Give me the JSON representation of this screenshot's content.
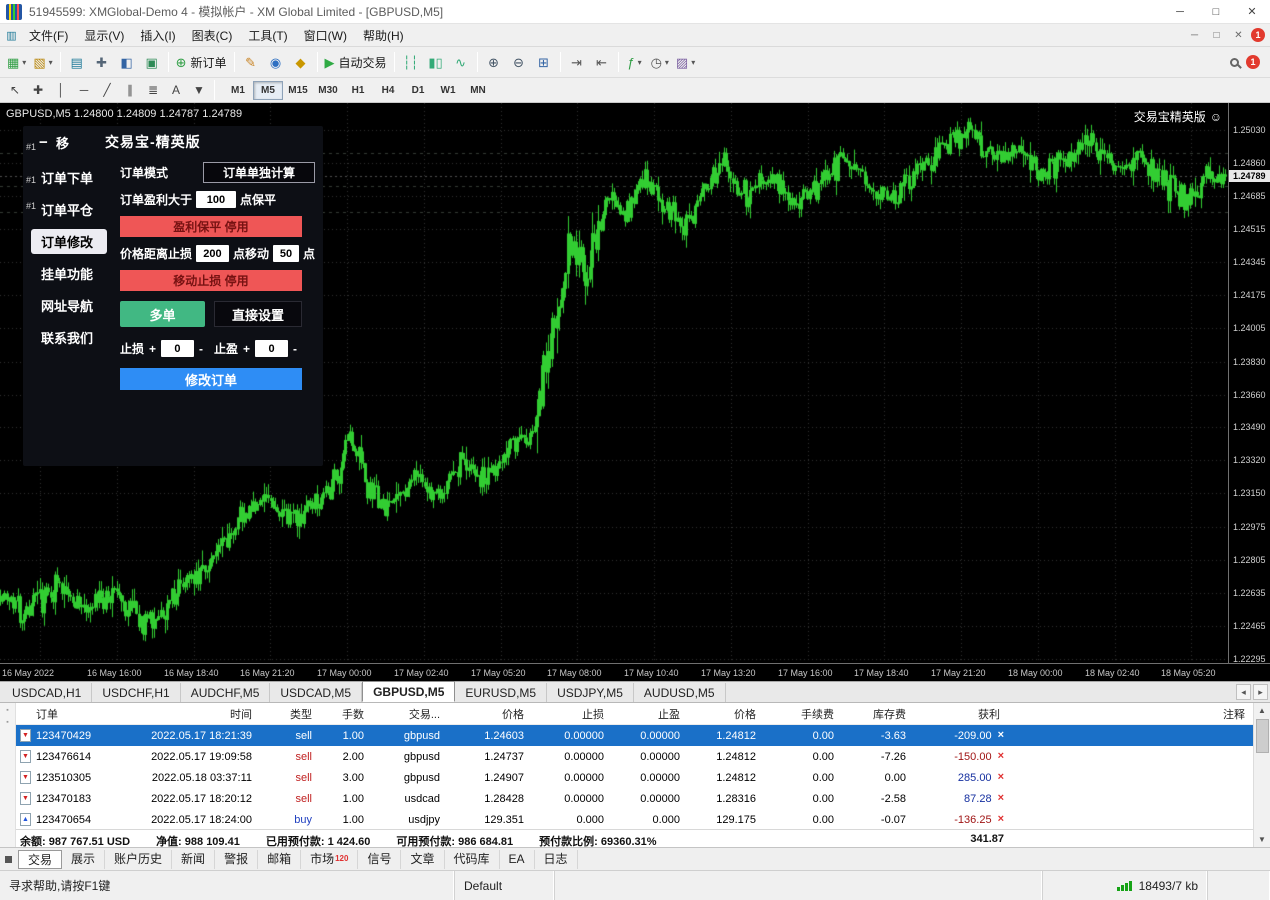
{
  "window": {
    "title": "51945599: XMGlobal-Demo 4 - 模拟帐户 - XM Global Limited - [GBPUSD,M5]",
    "minimize": "─",
    "maximize": "□",
    "close": "✕"
  },
  "menubar": {
    "items": [
      "文件(F)",
      "显示(V)",
      "插入(I)",
      "图表(C)",
      "工具(T)",
      "窗口(W)",
      "帮助(H)"
    ],
    "child_icon": "▥",
    "child_minimize": "─",
    "child_restore": "□",
    "child_close": "✕",
    "badge": "1"
  },
  "toolbar": {
    "groups": [
      {
        "buttons": [
          {
            "name": "new-chart",
            "glyph": "▦",
            "color": "#2f9e44",
            "dropdown": true
          },
          {
            "name": "profiles",
            "glyph": "▧",
            "color": "#b8860b",
            "dropdown": true
          }
        ]
      },
      {
        "buttons": [
          {
            "name": "market-watch",
            "glyph": "▤",
            "color": "#1f7a99"
          },
          {
            "name": "data-window",
            "glyph": "✚",
            "color": "#556677"
          },
          {
            "name": "navigator",
            "glyph": "◧",
            "color": "#3465a4"
          },
          {
            "name": "terminal",
            "glyph": "▣",
            "color": "#2e8b57"
          }
        ]
      },
      {
        "buttons": [
          {
            "name": "new-order",
            "glyph": "⊕",
            "color": "#2f9e44",
            "label": "新订单"
          }
        ]
      },
      {
        "buttons": [
          {
            "name": "metaeditor",
            "glyph": "✎",
            "color": "#c7801f"
          },
          {
            "name": "mql5-community",
            "glyph": "◉",
            "color": "#2d6fc2"
          },
          {
            "name": "market",
            "glyph": "◆",
            "color": "#c99700"
          }
        ]
      },
      {
        "buttons": [
          {
            "name": "autotrading",
            "glyph": "▶",
            "color": "#2faa44",
            "label": "自动交易"
          }
        ]
      },
      {
        "buttons": [
          {
            "name": "bar-chart",
            "glyph": "┆┆",
            "color": "#33aa77"
          },
          {
            "name": "candlestick-chart",
            "glyph": "▮▯",
            "color": "#33aa77"
          },
          {
            "name": "line-chart",
            "glyph": "∿",
            "color": "#33aa77"
          }
        ]
      },
      {
        "buttons": [
          {
            "name": "zoom-in",
            "glyph": "⊕",
            "color": "#445566"
          },
          {
            "name": "zoom-out",
            "glyph": "⊖",
            "color": "#445566"
          },
          {
            "name": "tile-windows",
            "glyph": "⊞",
            "color": "#3465a4"
          }
        ]
      },
      {
        "buttons": [
          {
            "name": "auto-scroll",
            "glyph": "⇥",
            "color": "#555555"
          },
          {
            "name": "chart-shift",
            "glyph": "⇤",
            "color": "#555555"
          }
        ]
      },
      {
        "buttons": [
          {
            "name": "indicators",
            "glyph": "ƒ",
            "color": "#2f9e44",
            "dropdown": true
          },
          {
            "name": "periods",
            "glyph": "◷",
            "color": "#555555",
            "dropdown": true
          },
          {
            "name": "templates",
            "glyph": "▨",
            "color": "#7a5fa0",
            "dropdown": true
          }
        ]
      }
    ],
    "badge": "1"
  },
  "drawing_tools": [
    {
      "name": "cursor",
      "glyph": "↖"
    },
    {
      "name": "crosshair",
      "glyph": "✚"
    },
    {
      "name": "vertical-line",
      "glyph": "│"
    },
    {
      "name": "horizontal-line",
      "glyph": "─"
    },
    {
      "name": "trendline",
      "glyph": "╱"
    },
    {
      "name": "equidistant-channel",
      "glyph": "∥"
    },
    {
      "name": "fibonacci-retracement",
      "glyph": "≣"
    },
    {
      "name": "text",
      "glyph": "A"
    },
    {
      "name": "arrow-objects",
      "glyph": "▼"
    }
  ],
  "timeframes": {
    "items": [
      "M1",
      "M5",
      "M15",
      "M30",
      "H1",
      "H4",
      "D1",
      "W1",
      "MN"
    ],
    "active": "M5"
  },
  "chart": {
    "ohlc_label": "GBPUSD,M5 1.24800 1.24809 1.24787 1.24789",
    "watermark": "交易宝精英版",
    "watermark_icon": "☺",
    "order_markers": [
      "#1",
      "#1",
      "#1"
    ],
    "price_axis_labels": [
      "1.25030",
      "1.24860",
      "1.24685",
      "1.24515",
      "1.24345",
      "1.24175",
      "1.24005",
      "1.23830",
      "1.23660",
      "1.23490",
      "1.23320",
      "1.23150",
      "1.22975",
      "1.22805",
      "1.22635",
      "1.22465",
      "1.22295"
    ],
    "current_price": "1.24789",
    "time_axis_labels": [
      "16 May 2022",
      "16 May 16:00",
      "16 May 18:40",
      "16 May 21:20",
      "17 May 00:00",
      "17 May 02:40",
      "17 May 05:20",
      "17 May 08:00",
      "17 May 10:40",
      "17 May 13:20",
      "17 May 16:00",
      "17 May 18:40",
      "17 May 21:20",
      "18 May 00:00",
      "18 May 02:40",
      "18 May 05:20"
    ]
  },
  "chart_data": {
    "type": "candlestick",
    "symbol": "GBPUSD",
    "timeframe": "M5",
    "last_ohlc": {
      "open": 1.248,
      "high": 1.24809,
      "low": 1.24787,
      "close": 1.24789
    },
    "ylim": [
      1.22272,
      1.25168
    ],
    "up_color": "#32cd32",
    "down_color": "#32cd32",
    "background": "#000000",
    "grid_color": "#333333",
    "order_line_prices": [
      1.24907,
      1.24737,
      1.24603
    ],
    "price_path": [
      [
        0.0,
        1.2262
      ],
      [
        0.02,
        1.2253
      ],
      [
        0.045,
        1.2266
      ],
      [
        0.07,
        1.2256
      ],
      [
        0.095,
        1.2262
      ],
      [
        0.115,
        1.2248
      ],
      [
        0.135,
        1.2257
      ],
      [
        0.155,
        1.2272
      ],
      [
        0.175,
        1.2282
      ],
      [
        0.195,
        1.2302
      ],
      [
        0.215,
        1.2312
      ],
      [
        0.235,
        1.2299
      ],
      [
        0.255,
        1.231
      ],
      [
        0.275,
        1.2322
      ],
      [
        0.285,
        1.2344
      ],
      [
        0.3,
        1.2318
      ],
      [
        0.315,
        1.2305
      ],
      [
        0.335,
        1.2325
      ],
      [
        0.355,
        1.2312
      ],
      [
        0.375,
        1.233
      ],
      [
        0.395,
        1.2322
      ],
      [
        0.415,
        1.2338
      ],
      [
        0.435,
        1.2345
      ],
      [
        0.45,
        1.2392
      ],
      [
        0.465,
        1.2448
      ],
      [
        0.48,
        1.2428
      ],
      [
        0.495,
        1.247
      ],
      [
        0.51,
        1.2458
      ],
      [
        0.525,
        1.2478
      ],
      [
        0.545,
        1.2462
      ],
      [
        0.56,
        1.2452
      ],
      [
        0.575,
        1.2472
      ],
      [
        0.59,
        1.2487
      ],
      [
        0.61,
        1.2468
      ],
      [
        0.63,
        1.248
      ],
      [
        0.65,
        1.2462
      ],
      [
        0.67,
        1.2478
      ],
      [
        0.69,
        1.2488
      ],
      [
        0.71,
        1.2475
      ],
      [
        0.73,
        1.2468
      ],
      [
        0.75,
        1.2483
      ],
      [
        0.77,
        1.2495
      ],
      [
        0.79,
        1.2503
      ],
      [
        0.81,
        1.2488
      ],
      [
        0.83,
        1.2495
      ],
      [
        0.85,
        1.2478
      ],
      [
        0.87,
        1.249
      ],
      [
        0.89,
        1.2498
      ],
      [
        0.91,
        1.2482
      ],
      [
        0.93,
        1.249
      ],
      [
        0.95,
        1.2475
      ],
      [
        0.97,
        1.2466
      ],
      [
        0.985,
        1.248
      ],
      [
        1.0,
        1.24789
      ]
    ]
  },
  "ea_panel": {
    "collapse_glyph": "−",
    "move_label": "移",
    "title": "交易宝-精英版",
    "menu": [
      {
        "label": "订单下单",
        "name": "panel-menu-place-order",
        "active": false
      },
      {
        "label": "订单平仓",
        "name": "panel-menu-close-order",
        "active": false
      },
      {
        "label": "订单修改",
        "name": "panel-menu-modify-order",
        "active": true
      },
      {
        "label": "挂单功能",
        "name": "panel-menu-pending-order",
        "active": false
      },
      {
        "label": "网址导航",
        "name": "panel-menu-web-links",
        "active": false
      },
      {
        "label": "联系我们",
        "name": "panel-menu-contact-us",
        "active": false
      }
    ],
    "order_mode_label": "订单模式",
    "order_mode_button": "订单单独计算",
    "profit_label": "订单盈利大于",
    "profit_value": "100",
    "profit_suffix": "点保平",
    "breakeven_button": "盈利保平 停用",
    "trail_label": "价格距离止损",
    "trail_distance": "200",
    "trail_mid": "点移动",
    "trail_step": "50",
    "trail_suffix": "点",
    "trailing_button": "移动止损 停用",
    "direction_button": "多单",
    "direct_set_button": "直接设置",
    "sl_label": "止损",
    "tp_label": "止盈",
    "plus_glyph": "+",
    "minus_glyph": "-",
    "sl_value": "0",
    "tp_value": "0",
    "modify_button": "修改订单"
  },
  "chart_tabs": {
    "items": [
      "USDCAD,H1",
      "USDCHF,H1",
      "AUDCHF,M5",
      "USDCAD,M5",
      "GBPUSD,M5",
      "EURUSD,M5",
      "USDJPY,M5",
      "AUDUSD,M5"
    ],
    "active_index": 4,
    "scroll_left": "◂",
    "scroll_right": "▸"
  },
  "terminal": {
    "columns": [
      "订单",
      "时间",
      "类型",
      "手数",
      "交易...",
      "价格",
      "止损",
      "止盈",
      "价格",
      "手续费",
      "库存费",
      "获利",
      "注释"
    ],
    "close_glyph": "×",
    "rows": [
      {
        "order": "123470429",
        "time": "2022.05.17 18:21:39",
        "type": "sell",
        "lots": "1.00",
        "symbol": "gbpusd",
        "price": "1.24603",
        "sl": "0.00000",
        "tp": "0.00000",
        "price2": "1.24812",
        "commission": "0.00",
        "swap": "-3.63",
        "profit": "-209.00",
        "selected": true
      },
      {
        "order": "123476614",
        "time": "2022.05.17 19:09:58",
        "type": "sell",
        "lots": "2.00",
        "symbol": "gbpusd",
        "price": "1.24737",
        "sl": "0.00000",
        "tp": "0.00000",
        "price2": "1.24812",
        "commission": "0.00",
        "swap": "-7.26",
        "profit": "-150.00",
        "selected": false
      },
      {
        "order": "123510305",
        "time": "2022.05.18 03:37:11",
        "type": "sell",
        "lots": "3.00",
        "symbol": "gbpusd",
        "price": "1.24907",
        "sl": "0.00000",
        "tp": "0.00000",
        "price2": "1.24812",
        "commission": "0.00",
        "swap": "0.00",
        "profit": "285.00",
        "selected": false
      },
      {
        "order": "123470183",
        "time": "2022.05.17 18:20:12",
        "type": "sell",
        "lots": "1.00",
        "symbol": "usdcad",
        "price": "1.28428",
        "sl": "0.00000",
        "tp": "0.00000",
        "price2": "1.28316",
        "commission": "0.00",
        "swap": "-2.58",
        "profit": "87.28",
        "selected": false
      },
      {
        "order": "123470654",
        "time": "2022.05.17 18:24:00",
        "type": "buy",
        "lots": "1.00",
        "symbol": "usdjpy",
        "price": "129.351",
        "sl": "0.000",
        "tp": "0.000",
        "price2": "129.175",
        "commission": "0.00",
        "swap": "-0.07",
        "profit": "-136.25",
        "selected": false
      }
    ],
    "summary": {
      "balance": "余额: 987 767.51 USD",
      "equity": "净值: 988 109.41",
      "margin": "已用预付款: 1 424.60",
      "free_margin": "可用预付款: 986 684.81",
      "margin_level": "预付款比例: 69360.31%",
      "profit": "341.87"
    }
  },
  "terminal_tabs": {
    "items": [
      {
        "label": "交易",
        "name": "terminal-tab-trade",
        "active": true
      },
      {
        "label": "展示",
        "name": "terminal-tab-exposure",
        "active": false
      },
      {
        "label": "账户历史",
        "name": "terminal-tab-account-history",
        "active": false
      },
      {
        "label": "新闻",
        "name": "terminal-tab-news",
        "active": false
      },
      {
        "label": "警报",
        "name": "terminal-tab-alerts",
        "active": false
      },
      {
        "label": "邮箱",
        "name": "terminal-tab-mailbox",
        "active": false
      },
      {
        "label": "市场",
        "name": "terminal-tab-market",
        "active": false,
        "badge": "120"
      },
      {
        "label": "信号",
        "name": "terminal-tab-signals",
        "active": false
      },
      {
        "label": "文章",
        "name": "terminal-tab-articles",
        "active": false
      },
      {
        "label": "代码库",
        "name": "terminal-tab-code-base",
        "active": false
      },
      {
        "label": "EA",
        "name": "terminal-tab-experts",
        "active": false
      },
      {
        "label": "日志",
        "name": "terminal-tab-journal",
        "active": false
      }
    ]
  },
  "statusbar": {
    "help": "寻求帮助,请按F1键",
    "profile": "Default",
    "connection": "18493/7 kb"
  }
}
